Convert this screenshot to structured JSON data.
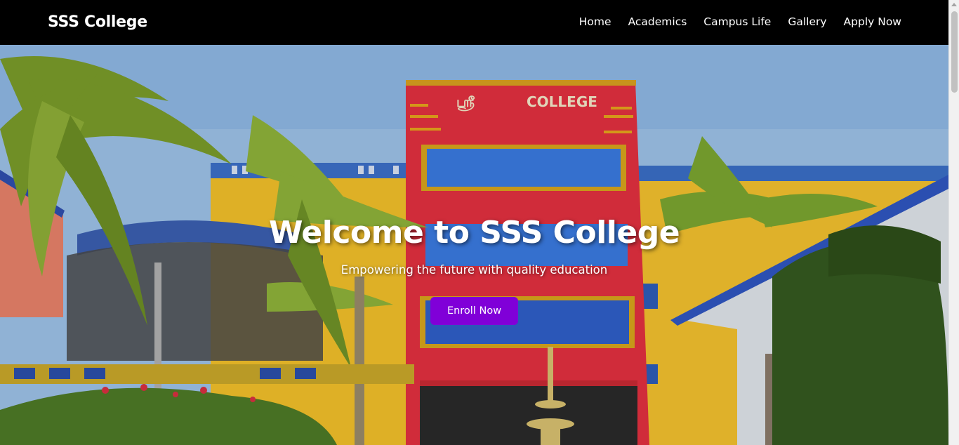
{
  "navbar": {
    "brand": "SSS College",
    "links": [
      "Home",
      "Academics",
      "Campus Life",
      "Gallery",
      "Apply Now"
    ]
  },
  "hero": {
    "title": "Welcome to SSS College",
    "subtitle": "Empowering the future with quality education",
    "cta_label": "Enroll Now",
    "building_sign": "COLLEGE",
    "building_sign_logo": "ஸ்ரீ"
  },
  "colors": {
    "navbar_bg": "#000000",
    "cta_bg": "#8000d8",
    "text": "#ffffff",
    "building_red": "#e0283a",
    "building_yellow": "#f2c12e",
    "sky": "#9fc3ea"
  }
}
